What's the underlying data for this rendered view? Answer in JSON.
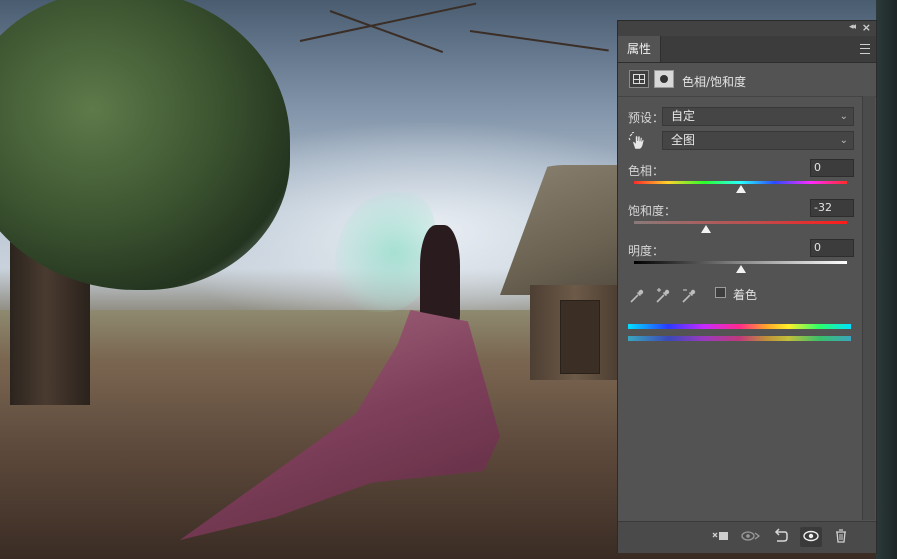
{
  "panel": {
    "tab_label": "属性",
    "adjustment_title": "色相/饱和度",
    "preset_label": "预设：",
    "preset_value": "自定",
    "channel_value": "全图",
    "hue_label": "色相：",
    "hue_value": "0",
    "hue_level": 0.5,
    "saturation_label": "饱和度：",
    "saturation_value": "-32",
    "saturation_level": 0.34,
    "lightness_label": "明度：",
    "lightness_value": "0",
    "lightness_level": 0.5,
    "colorize_label": "着色",
    "colorize_checked": false
  },
  "icons": {
    "collapse": "double-chevron-left-icon",
    "close": "close-icon",
    "menu": "panel-menu-icon",
    "hand": "targeted-adjustment-hand-icon",
    "eyedroppers": [
      "eyedropper-icon",
      "eyedropper-plus-icon",
      "eyedropper-minus-icon"
    ],
    "footer": [
      "clip-to-layer-icon",
      "view-previous-state-icon",
      "reset-icon",
      "visibility-eye-icon",
      "trash-icon"
    ]
  },
  "colors": {
    "panel_bg": "#535353",
    "tab_bar_bg": "#3c3c3c",
    "input_bg": "#454545"
  }
}
